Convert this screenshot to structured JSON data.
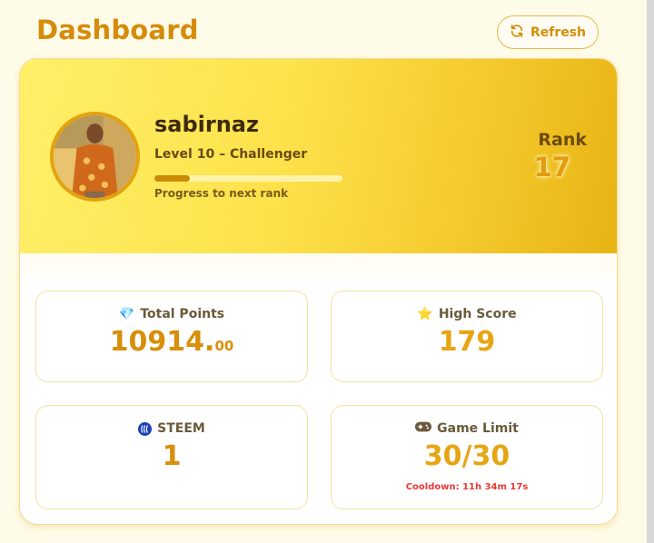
{
  "header": {
    "title": "Dashboard",
    "refresh_label": "Refresh"
  },
  "profile": {
    "username": "sabirnaz",
    "level_text": "Level 10 – Challenger",
    "progress_fraction": 0.19,
    "progress_label": "Progress to next rank",
    "rank_label": "Rank",
    "rank_value": "17"
  },
  "stats": {
    "total_points": {
      "icon": "gem-icon",
      "label": "Total Points",
      "value_int": "10914.",
      "value_dec": "00"
    },
    "high_score": {
      "icon": "star-icon",
      "label": "High Score",
      "value": "179"
    },
    "steem": {
      "icon": "steem-logo-icon",
      "label": "STEEM",
      "value": "1"
    },
    "game_limit": {
      "icon": "gamepad-icon",
      "label": "Game Limit",
      "value": "30/30",
      "cooldown": "Cooldown: 11h 34m 17s"
    }
  },
  "colors": {
    "accent": "#d68c0a",
    "gold": "#e6a514",
    "page_bg": "#fffbe9",
    "danger": "#e53935"
  }
}
